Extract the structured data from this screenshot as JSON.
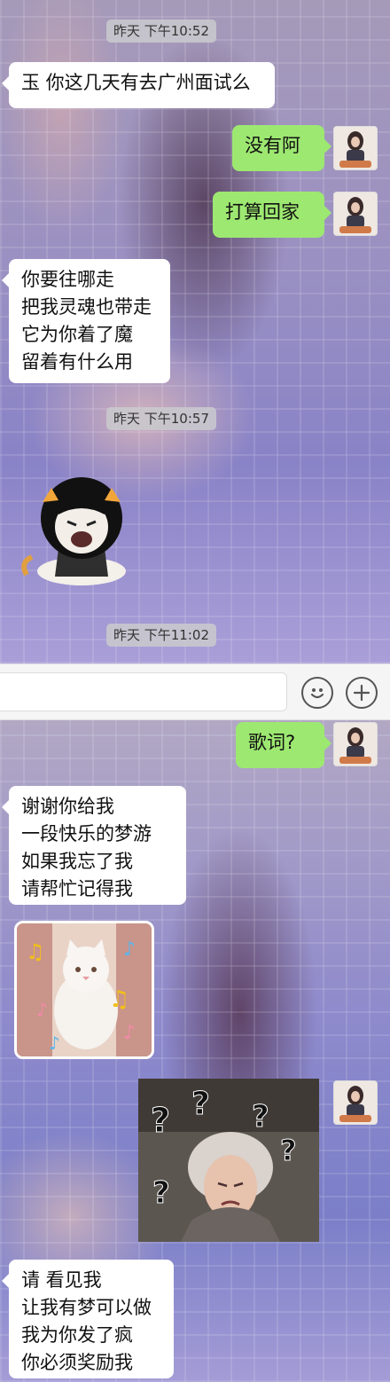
{
  "panel_top": {
    "messages": [
      {
        "type": "timestamp",
        "text": "昨天 下午10:52"
      },
      {
        "type": "text",
        "side": "in",
        "lines": [
          "玉 你这几天有去广州面试么"
        ]
      },
      {
        "type": "text",
        "side": "out",
        "lines": [
          "没有阿"
        ]
      },
      {
        "type": "text",
        "side": "out",
        "lines": [
          "打算回家"
        ]
      },
      {
        "type": "text",
        "side": "in",
        "lines": [
          "你要往哪走",
          "把我灵魂也带走",
          "它为你着了魔",
          "留着有什么用"
        ]
      },
      {
        "type": "timestamp",
        "text": "昨天 下午10:57"
      },
      {
        "type": "sticker",
        "side": "in",
        "icon": "laughing-cartoon-sticker"
      },
      {
        "type": "timestamp",
        "text": "昨天 下午11:02"
      }
    ]
  },
  "input_bar": {
    "text_value": "",
    "emoji_icon": "smiley-face-icon",
    "plus_icon": "plus-icon"
  },
  "panel_bottom": {
    "messages": [
      {
        "type": "text",
        "side": "out",
        "lines": [
          "歌词?"
        ]
      },
      {
        "type": "text",
        "side": "in",
        "lines": [
          "谢谢你给我",
          "一段快乐的梦游",
          "如果我忘了我",
          "请帮忙记得我"
        ]
      },
      {
        "type": "sticker",
        "side": "in",
        "icon": "cat-music-notes-sticker"
      },
      {
        "type": "sticker",
        "side": "out",
        "icon": "confused-woman-question-marks-sticker"
      },
      {
        "type": "text",
        "side": "in",
        "lines": [
          "请 看见我",
          "让我有梦可以做",
          "我为你发了疯",
          "你必须奖励我"
        ]
      }
    ]
  },
  "colors": {
    "outgoing_bubble": "#9de871",
    "incoming_bubble": "#ffffff",
    "timestamp_bg": "#c8c8cd"
  }
}
